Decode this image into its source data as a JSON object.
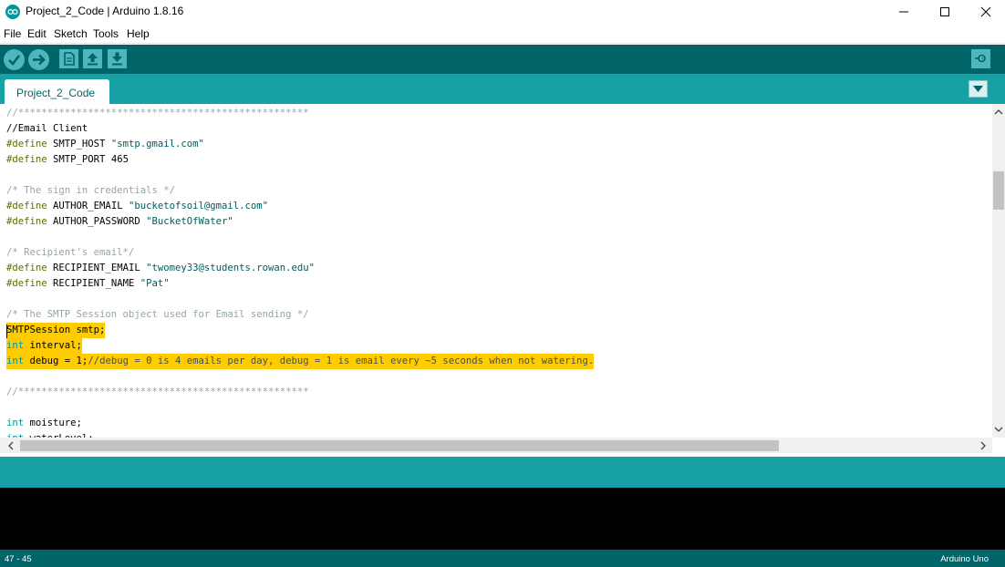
{
  "window": {
    "title": "Project_2_Code | Arduino 1.8.16",
    "minimize_glyph": "—",
    "maximize_glyph": "☐",
    "close_glyph": "✕"
  },
  "menu": [
    "File",
    "Edit",
    "Sketch",
    "Tools",
    "Help"
  ],
  "toolbar": {
    "buttons": [
      "verify-icon",
      "upload-icon",
      "new-icon",
      "open-icon",
      "save-icon",
      "serial-monitor-icon"
    ]
  },
  "tabs": [
    {
      "label": "Project_2_Code"
    }
  ],
  "editor": {
    "lines": [
      [
        {
          "t": "//**************************************************",
          "c": "comment"
        }
      ],
      [
        {
          "t": "//Email Client",
          "c": "plain"
        }
      ],
      [
        {
          "t": "#define",
          "c": "define"
        },
        {
          "t": " SMTP_HOST ",
          "c": "plain"
        },
        {
          "t": "\"smtp.gmail.com\"",
          "c": "string"
        }
      ],
      [
        {
          "t": "#define",
          "c": "define"
        },
        {
          "t": " SMTP_PORT 465",
          "c": "plain"
        }
      ],
      [],
      [
        {
          "t": "/* The sign in credentials */",
          "c": "comment"
        }
      ],
      [
        {
          "t": "#define",
          "c": "define"
        },
        {
          "t": " AUTHOR_EMAIL ",
          "c": "plain"
        },
        {
          "t": "\"bucketofsoil@gmail.com\"",
          "c": "string"
        }
      ],
      [
        {
          "t": "#define",
          "c": "define"
        },
        {
          "t": " AUTHOR_PASSWORD ",
          "c": "plain"
        },
        {
          "t": "\"BucketOfWater\"",
          "c": "string"
        }
      ],
      [],
      [
        {
          "t": "/* Recipient's email*/",
          "c": "comment"
        }
      ],
      [
        {
          "t": "#define",
          "c": "define"
        },
        {
          "t": " RECIPIENT_EMAIL ",
          "c": "plain"
        },
        {
          "t": "\"twomey33@students.rowan.edu\"",
          "c": "string"
        }
      ],
      [
        {
          "t": "#define",
          "c": "define"
        },
        {
          "t": " RECIPIENT_NAME ",
          "c": "plain"
        },
        {
          "t": "\"Pat\"",
          "c": "string"
        }
      ],
      [],
      [
        {
          "t": "/* The SMTP Session object used for Email sending */",
          "c": "comment"
        }
      ],
      [
        {
          "t": "SMTPSession smtp;",
          "c": "plain"
        }
      ],
      [
        {
          "t": "int",
          "c": "type"
        },
        {
          "t": " interval;",
          "c": "plain"
        }
      ],
      [
        {
          "t": "int",
          "c": "type"
        },
        {
          "t": " debug = 1;",
          "c": "plain"
        },
        {
          "t": "//debug = 0 is 4 emails per day, debug = 1 is email every ~5 seconds when not watering.",
          "c": "linecomment"
        }
      ],
      [],
      [
        {
          "t": "//**************************************************",
          "c": "comment"
        }
      ],
      [],
      [
        {
          "t": "int",
          "c": "type"
        },
        {
          "t": " moisture;",
          "c": "plain"
        }
      ],
      [
        {
          "t": "int",
          "c": "type"
        },
        {
          "t": " waterLevel;",
          "c": "plain"
        }
      ]
    ],
    "highlighted_lines": [
      14,
      15,
      16
    ]
  },
  "status": {
    "line_position": "47 - 45",
    "board": "Arduino Uno"
  },
  "colors": {
    "toolbar": "#006468",
    "tabbar": "#17a1a5",
    "highlight": "#ffcc00",
    "console": "#000000"
  }
}
